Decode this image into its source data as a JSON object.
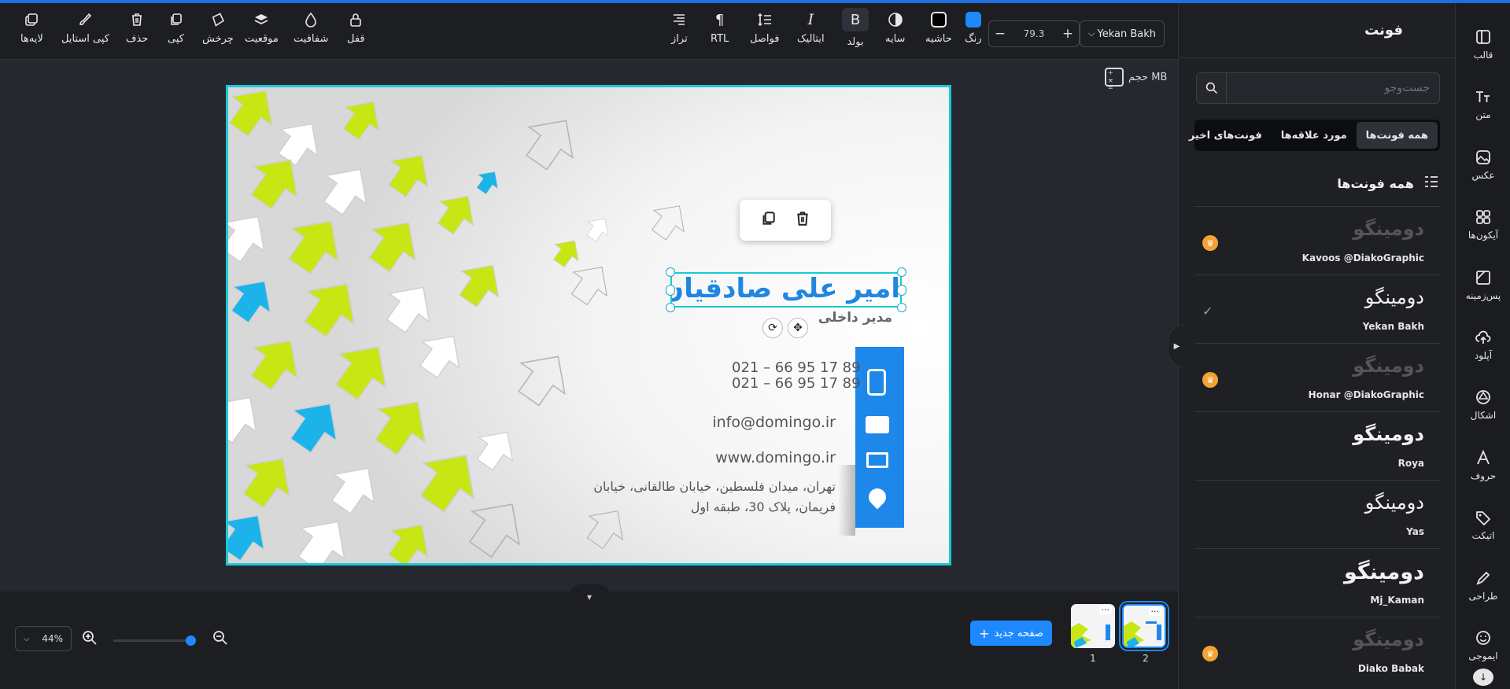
{
  "toolbar": {
    "left_tools": [
      {
        "label": "لایه‌ها",
        "icon": "layers-icon"
      },
      {
        "label": "کپی استایل",
        "icon": "brush-icon"
      },
      {
        "label": "حذف",
        "icon": "trash-icon"
      },
      {
        "label": "کپی",
        "icon": "copy-icon"
      },
      {
        "label": "چرخش",
        "icon": "rotate-icon"
      },
      {
        "label": "موقعیت",
        "icon": "stack-icon"
      },
      {
        "label": "شفافیت",
        "icon": "drop-icon"
      },
      {
        "label": "قفل",
        "icon": "lock-icon"
      }
    ],
    "align_label": "تراز",
    "rtl_label": "RTL",
    "spacing_label": "فواصل",
    "italic_label": "ایتالیک",
    "bold_label": "بولد",
    "shadow_label": "سایه",
    "border_label": "حاشیه",
    "color_label": "رنگ",
    "font_size": "79.3",
    "font_name": "Yekan Bakh"
  },
  "canvas": {
    "size_label": "حجم MB",
    "name": "امیر علی صادقیان",
    "title": "مدیر داخلی",
    "phone1": "021 – 66 95 17 89",
    "phone2": "021 – 66 95 17 89",
    "email": "info@domingo.ir",
    "website": "www.domingo.ir",
    "address1": "تهران، میدان فلسطین، خیابان طالقانی، خیابان",
    "address2": "فریمان، پلاک 30، طبقه اول"
  },
  "bottom": {
    "zoom": "44%",
    "new_page": "صفحه جدید",
    "pages": [
      "1",
      "2"
    ]
  },
  "panel": {
    "title": "فونت",
    "search_placeholder": "جست‌وجو",
    "tabs": [
      "همه فونت‌ها",
      "مورد علاقه‌ها",
      "فونت‌های اخیر"
    ],
    "section_title": "همه فونت‌ها",
    "fonts": [
      {
        "sample": "دومینگو",
        "name": "Kavoos @DiakoGraphic",
        "badge": "crown"
      },
      {
        "sample": "دومینگو",
        "name": "Yekan Bakh",
        "badge": "check"
      },
      {
        "sample": "دومینگو",
        "name": "Honar @DiakoGraphic",
        "badge": "crown"
      },
      {
        "sample": "دومینگو",
        "name": "Roya",
        "badge": ""
      },
      {
        "sample": "دومینگو",
        "name": "Yas",
        "badge": ""
      },
      {
        "sample": "دومینگو",
        "name": "Mj_Kaman",
        "badge": ""
      },
      {
        "sample": "دومینگو",
        "name": "Diako Babak",
        "badge": "crown"
      }
    ]
  },
  "nav": [
    {
      "label": "قالب",
      "icon": "template-icon"
    },
    {
      "label": "متن",
      "icon": "text-icon"
    },
    {
      "label": "عکس",
      "icon": "photo-icon"
    },
    {
      "label": "آیکون‌ها",
      "icon": "icons-grid-icon"
    },
    {
      "label": "پس‌زمینه",
      "icon": "background-icon"
    },
    {
      "label": "آپلود",
      "icon": "upload-icon"
    },
    {
      "label": "اشکال",
      "icon": "shapes-icon"
    },
    {
      "label": "حروف",
      "icon": "letters-icon"
    },
    {
      "label": "اتیکت",
      "icon": "sticker-icon"
    },
    {
      "label": "طراحی",
      "icon": "pen-icon"
    },
    {
      "label": "ایموجی",
      "icon": "emoji-icon"
    }
  ],
  "colors": {
    "accent": "#1e88ff",
    "selection": "#18c9d8",
    "lime": "#c8e614",
    "cyan": "#1bb3ea",
    "name_blue": "#1f86e2"
  }
}
